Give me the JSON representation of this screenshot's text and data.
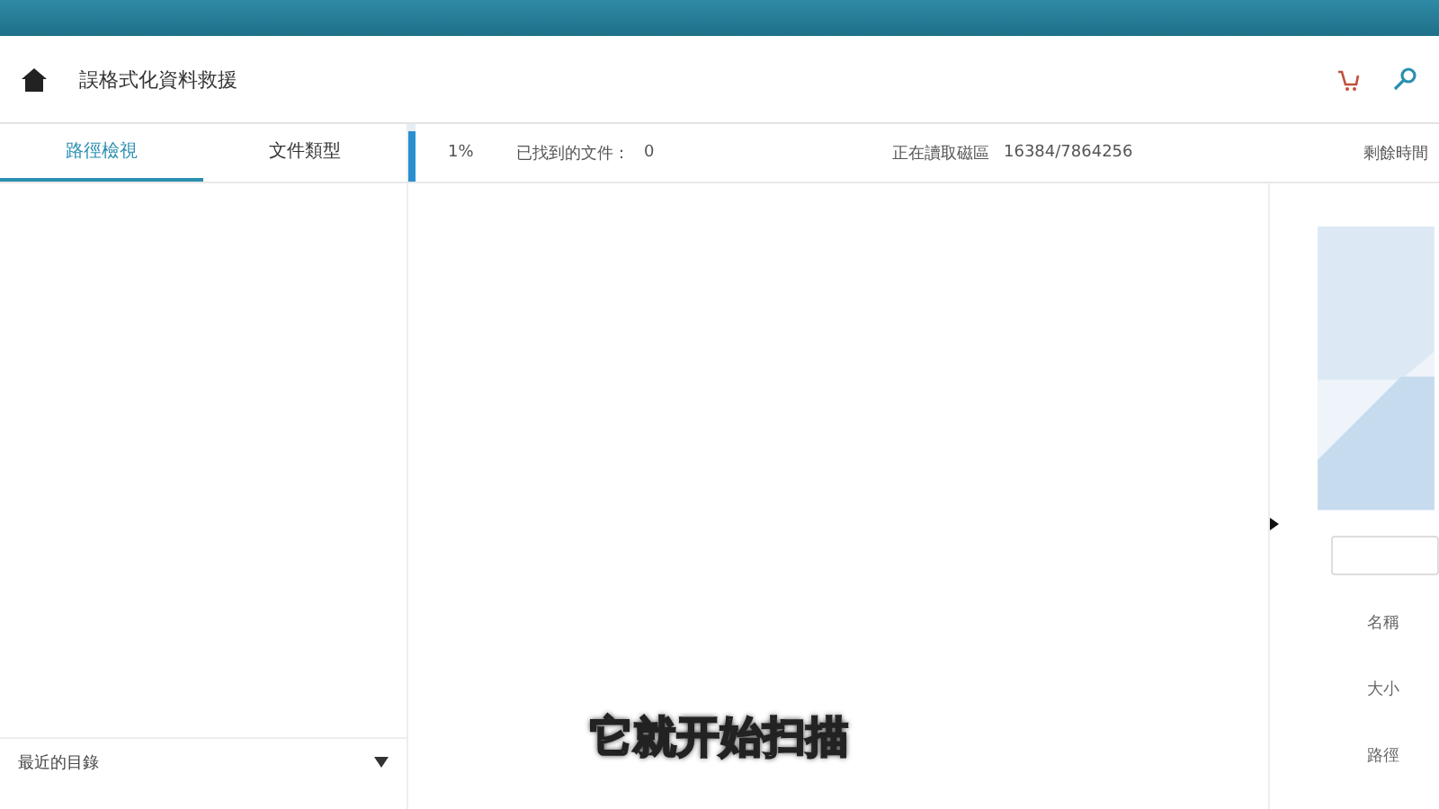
{
  "header": {
    "title": "誤格式化資料救援"
  },
  "tabs": [
    {
      "label": "路徑檢視",
      "selected": true
    },
    {
      "label": "文件類型",
      "selected": false
    }
  ],
  "scan": {
    "percent": "1%",
    "found_label": "已找到的文件：",
    "found": "0",
    "sector_label": "正在讀取磁區",
    "sector": "16384/7864256",
    "remaining_label": "剩餘時間"
  },
  "folder_section": {
    "title": "最近的目錄",
    "expanded": true
  },
  "details": {
    "labels": [
      "名稱",
      "大小",
      "路徑"
    ]
  },
  "subtitle": "它就开始扫描"
}
